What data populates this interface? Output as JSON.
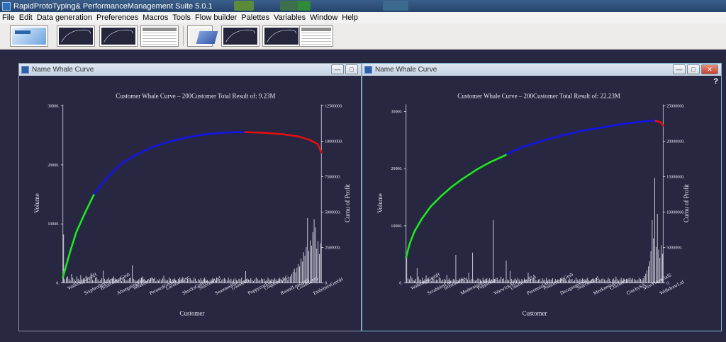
{
  "app": {
    "title": "RapidProtoTyping& PerformanceManagement Suite 5.0.1"
  },
  "menu": {
    "items": [
      "File",
      "Edit",
      "Data generation",
      "Preferences",
      "Macros",
      "Tools",
      "Flow builder",
      "Palettes",
      "Variables",
      "Window",
      "Help"
    ]
  },
  "toolbar": {
    "buttons": [
      {
        "icon": "report-thumbnail-icon",
        "interactable": true
      },
      {
        "icon": "whale-curve-thumbnail-icon",
        "interactable": true
      },
      {
        "icon": "whale-curve-thumbnail-icon",
        "interactable": true
      },
      {
        "icon": "table-thumbnail-icon",
        "interactable": true
      },
      {
        "icon": "3d-chart-thumbnail-icon",
        "interactable": true
      },
      {
        "icon": "whale-curve-thumbnail-icon",
        "interactable": true
      },
      {
        "icon": "whale-curve-thumbnail-icon",
        "interactable": true
      },
      {
        "icon": "table-thumbnail-icon",
        "interactable": true
      }
    ]
  },
  "colors": {
    "background": "#282843",
    "plot_bg": "#272742",
    "axis": "#d8d8e6",
    "curve_green": "#1ee81e",
    "curve_blue": "#1414e6",
    "curve_red": "#e01010"
  },
  "windows": [
    {
      "title": "Name Whale Curve",
      "controls": [
        "minimize",
        "maximize"
      ],
      "help": "",
      "chart_data": {
        "type": "bar+line",
        "title": "Customer Whale Curve – 200Customer Total Result of: 9.23M",
        "xlabel": "Customer",
        "ylabel": "Volume",
        "y2label": "Cumu of Profit",
        "ylim": [
          0,
          30000
        ],
        "yticks": [
          0,
          10000,
          20000,
          30000
        ],
        "ytick_labels": [
          "0.",
          "10000.",
          "20000.",
          "30000."
        ],
        "y2lim": [
          0,
          12500000
        ],
        "y2ticks": [
          0,
          2500000,
          5000000,
          7500000,
          10000000,
          12500000
        ],
        "y2tick_labels": [
          "0.",
          "2500000.",
          "5000000.",
          "7500000.",
          "10000000.",
          "12500000."
        ],
        "categories": [
          "WalkingsGmbH",
          "SixpbrothersGm",
          "BifurcationGmb",
          "AbnegatingLtd",
          "WeakestSA",
          "PerusedGmbH",
          "LaceratedInc",
          "ShucksGmbH",
          "SearcherLtd",
          "SeasonedInc",
          "LoonsAG",
          "PoppycockInc",
          "CoquettesAG",
          "RentalLeasingS",
          "CoilsetsAG",
          "EmbittersGmbH"
        ],
        "customer_count": 200,
        "bars": [
          8200,
          600,
          900,
          1100,
          700,
          400,
          1500,
          900,
          600,
          300,
          1100,
          700,
          500,
          1300,
          600,
          800,
          400,
          1200,
          900,
          300,
          700,
          1700,
          500,
          400,
          900,
          1000,
          600,
          300,
          500,
          800,
          2100,
          700,
          400,
          600,
          900,
          500,
          300,
          700,
          1100,
          800,
          600,
          400,
          500,
          900,
          300,
          1000,
          700,
          500,
          400,
          600,
          800,
          900,
          3000,
          700,
          500,
          300,
          400,
          600,
          800,
          900,
          1100,
          700,
          500,
          300,
          600,
          400,
          800,
          700,
          500,
          900,
          300,
          600,
          400,
          700,
          500,
          800,
          1200,
          600,
          400,
          500,
          900,
          700,
          300,
          600,
          800,
          500,
          400,
          700,
          900,
          600,
          1000,
          400,
          500,
          300,
          700,
          600,
          800,
          500,
          400,
          900,
          700,
          300,
          600,
          500,
          800,
          400,
          700,
          900,
          600,
          500,
          300,
          400,
          600,
          800,
          700,
          500,
          900,
          400,
          600,
          300,
          500,
          700,
          800,
          600,
          400,
          900,
          500,
          700,
          300,
          600,
          800,
          500,
          400,
          700,
          600,
          900,
          300,
          500,
          2000,
          700,
          600,
          400,
          800,
          500,
          300,
          600,
          900,
          700,
          400,
          500,
          800,
          600,
          700,
          300,
          500,
          900,
          600,
          400,
          700,
          500,
          800,
          600,
          300,
          700,
          900,
          500,
          400,
          600,
          800,
          700,
          500,
          900,
          1100,
          1500,
          1900,
          2400,
          1800,
          2600,
          3200,
          2800,
          4100,
          3600,
          5200,
          4600,
          6100,
          11000,
          5400,
          7200,
          6300,
          8600,
          10800,
          9400,
          5800,
          7100,
          4900,
          6700
        ],
        "cumulative_profit": [
          [
            0,
            0.4
          ],
          [
            8,
            2.2
          ],
          [
            15,
            3.6
          ],
          [
            25,
            5.0
          ],
          [
            35,
            6.3
          ],
          [
            50,
            7.5
          ],
          [
            65,
            8.4
          ],
          [
            80,
            9.0
          ],
          [
            100,
            9.6
          ],
          [
            120,
            10.0
          ],
          [
            140,
            10.3
          ],
          [
            160,
            10.5
          ],
          [
            180,
            10.62
          ],
          [
            203,
            10.65
          ],
          [
            225,
            10.6
          ],
          [
            245,
            10.5
          ],
          [
            262,
            10.35
          ],
          [
            275,
            10.1
          ],
          [
            284,
            9.8
          ],
          [
            288,
            9.23
          ]
        ],
        "curve_break_indexes": [
          4,
          13
        ]
      }
    },
    {
      "title": "Name Whale Curve",
      "controls": [
        "minimize",
        "maximize",
        "close"
      ],
      "help": "?",
      "chart_data": {
        "type": "bar+line",
        "title": "Customer Whale Curve – 200Customer Total Result of: 22.23M",
        "xlabel": "Customer",
        "ylabel": "Volume",
        "y2label": "Cumu of Profit",
        "ylim": [
          0,
          31000
        ],
        "yticks": [
          0,
          10000,
          20000,
          30000
        ],
        "ytick_labels": [
          "0.",
          "10000.",
          "20000.",
          "30000."
        ],
        "y2lim": [
          0,
          25000000
        ],
        "y2ticks": [
          0,
          5000000,
          10000000,
          15000000,
          20000000,
          25000000
        ],
        "y2tick_labels": [
          "0.",
          "5000000.",
          "10000000.",
          "15000000.",
          "20000000.",
          "25000000."
        ],
        "categories": [
          "WalkingsGmbH",
          "ScrabblerLtd",
          "IrresoluteSs",
          "ModernizedAG",
          "PuppiesInc",
          "WarwickAG",
          "UnaffectedSA",
          "PerennialAG",
          "PositioningGmb",
          "DecapitatesSA",
          "SearcherLtd",
          "MeeknessAG",
          "ChicherInc",
          "CinchySA",
          "MiscFinancialS",
          "WithdrawLtd"
        ],
        "customer_count": 200,
        "bars": [
          5200,
          800,
          600,
          1200,
          900,
          500,
          400,
          700,
          2600,
          1100,
          600,
          500,
          900,
          400,
          700,
          1300,
          600,
          800,
          500,
          300,
          900,
          700,
          400,
          600,
          500,
          1000,
          800,
          400,
          600,
          700,
          500,
          1400,
          600,
          800,
          400,
          500,
          700,
          600,
          4900,
          500,
          300,
          800,
          600,
          700,
          400,
          500,
          900,
          600,
          1800,
          500,
          700,
          5300,
          600,
          400,
          500,
          800,
          700,
          600,
          300,
          900,
          500,
          600,
          700,
          400,
          800,
          500,
          600,
          11000,
          700,
          400,
          900,
          500,
          600,
          1100,
          700,
          800,
          400,
          3900,
          600,
          500,
          2100,
          700,
          400,
          600,
          800,
          500,
          900,
          600,
          300,
          700,
          500,
          800,
          600,
          400,
          1800,
          500,
          700,
          600,
          800,
          900,
          500,
          400,
          600,
          700,
          300,
          800,
          500,
          600,
          900,
          400,
          700,
          500,
          600,
          800,
          300,
          700,
          500,
          600,
          400,
          800,
          900,
          500,
          700,
          600,
          400,
          500,
          800,
          600,
          700,
          300,
          500,
          900,
          600,
          400,
          700,
          500,
          800,
          600,
          300,
          700,
          900,
          500,
          400,
          600,
          800,
          700,
          500,
          900,
          400,
          600,
          500,
          700,
          800,
          600,
          400,
          500,
          900,
          700,
          300,
          600,
          800,
          500,
          1100,
          700,
          400,
          600,
          900,
          500,
          800,
          600,
          700,
          400,
          500,
          900,
          600,
          800,
          700,
          500,
          400,
          600,
          900,
          700,
          500,
          800,
          1200,
          1600,
          2200,
          2900,
          3800,
          5600,
          11000,
          7800,
          18400,
          6300,
          12100,
          5800,
          4400,
          6600,
          5100
        ],
        "cumulative_profit": [
          [
            0,
            3.6
          ],
          [
            5,
            5.5
          ],
          [
            12,
            7.3
          ],
          [
            22,
            9.0
          ],
          [
            35,
            10.8
          ],
          [
            50,
            12.3
          ],
          [
            65,
            13.6
          ],
          [
            80,
            14.7
          ],
          [
            100,
            16.0
          ],
          [
            120,
            17.1
          ],
          [
            140,
            18.0
          ],
          [
            143,
            18.2
          ],
          [
            165,
            19.2
          ],
          [
            190,
            20.0
          ],
          [
            220,
            20.8
          ],
          [
            250,
            21.5
          ],
          [
            280,
            22.0
          ],
          [
            310,
            22.5
          ],
          [
            335,
            22.8
          ],
          [
            350,
            22.9
          ],
          [
            353,
            22.9
          ],
          [
            358,
            22.8
          ],
          [
            361,
            22.6
          ],
          [
            364,
            22.23
          ]
        ],
        "curve_break_indexes": [
          11,
          20
        ]
      }
    }
  ]
}
